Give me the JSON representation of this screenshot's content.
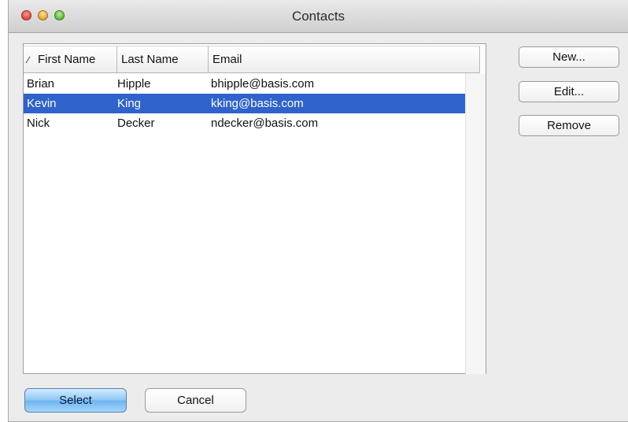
{
  "window": {
    "title": "Contacts"
  },
  "table": {
    "columns": [
      "First Name",
      "Last Name",
      "Email"
    ],
    "sort_icon": "sort-ascending-icon",
    "rows": [
      {
        "first": "Brian",
        "last": "Hipple",
        "email": "bhipple@basis.com"
      },
      {
        "first": "Kevin",
        "last": "King",
        "email": "kking@basis.com"
      },
      {
        "first": "Nick",
        "last": "Decker",
        "email": "ndecker@basis.com"
      }
    ],
    "selected_row": 1
  },
  "actions": {
    "new_label": "New...",
    "edit_label": "Edit...",
    "remove_label": "Remove"
  },
  "footer": {
    "select_label": "Select",
    "cancel_label": "Cancel"
  },
  "colors": {
    "selection": "#2f63cb",
    "window_bg": "#ececec",
    "default_button": "#8cc6f6"
  }
}
